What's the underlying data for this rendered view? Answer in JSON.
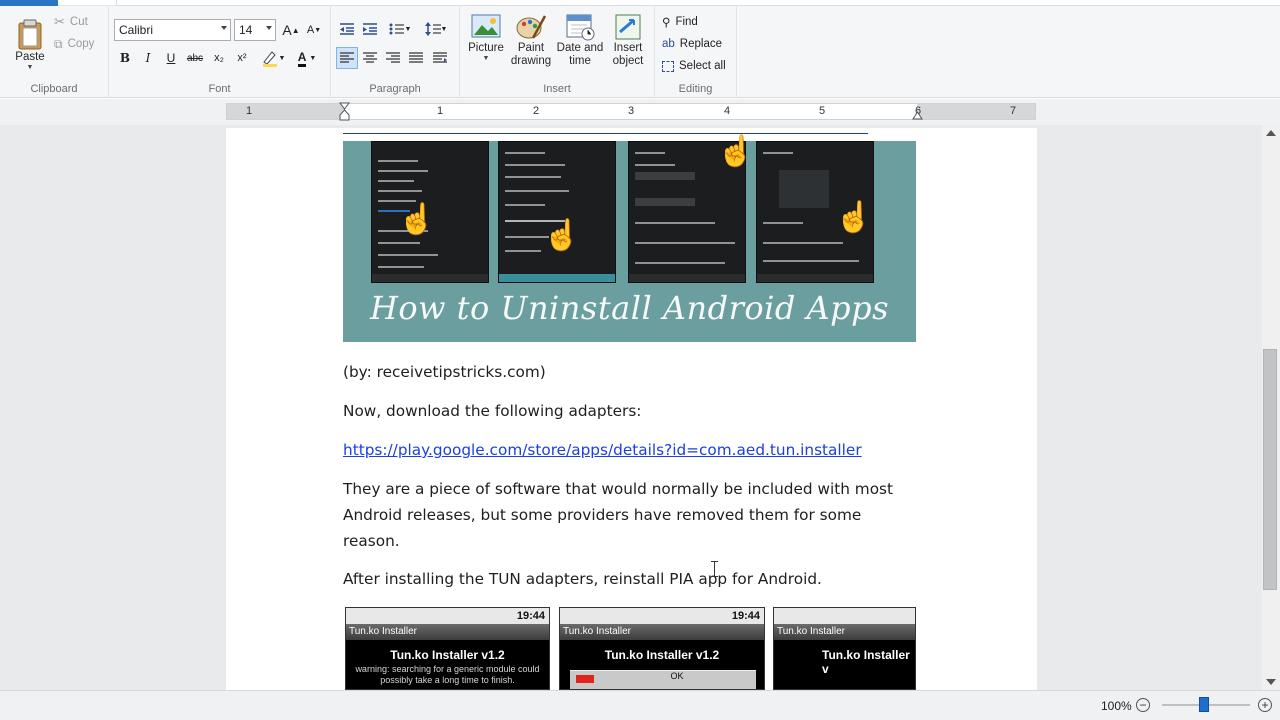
{
  "ribbon": {
    "clipboard": {
      "label": "Clipboard",
      "paste": "Paste",
      "cut": "Cut",
      "copy": "Copy"
    },
    "font": {
      "label": "Font",
      "family": "Calibri",
      "size": "14",
      "bold": "B",
      "italic": "I",
      "underline": "U",
      "strike": "abc",
      "subscript": "x₂",
      "superscript": "x²",
      "color_letter": "A",
      "grow_letter": "A",
      "shrink_letter": "A"
    },
    "paragraph": {
      "label": "Paragraph"
    },
    "insert": {
      "label": "Insert",
      "picture": "Picture",
      "paint": "Paint drawing",
      "datetime": "Date and time",
      "object": "Insert object"
    },
    "editing": {
      "label": "Editing",
      "find": "Find",
      "replace": "Replace",
      "select_all": "Select all"
    }
  },
  "ruler": {
    "numbers": [
      "1",
      "1",
      "2",
      "3",
      "4",
      "5",
      "6",
      "7"
    ]
  },
  "document": {
    "image1_title": "How to Uninstall Android Apps",
    "credit": "(by: receivetipstricks.com)",
    "line_download": "Now, download the following adapters:",
    "link": "https://play.google.com/store/apps/details?id=com.aed.tun.installer",
    "para_software_1": "They are a piece of software that would normally be included with most",
    "para_software_2": "Android releases, but some providers have removed them for some",
    "para_software_3": "reason.",
    "line_reinstall": "After installing the TUN adapters, reinstall PIA app for Android.",
    "shots": [
      {
        "time": "19:44",
        "titlebar": "Tun.ko Installer",
        "heading": "Tun.ko Installer v1.2",
        "sub": "warning: searching for a generic module could possibly take a long time to finish."
      },
      {
        "time": "19:44",
        "titlebar": "Tun.ko Installer",
        "heading": "Tun.ko Installer v1.2",
        "sub": "OK"
      },
      {
        "time": "",
        "titlebar": "Tun.ko Installer",
        "heading": "Tun.ko Installer v",
        "sub": ""
      }
    ]
  },
  "status": {
    "zoom": "100%",
    "zoom_out": "−",
    "zoom_in": "+",
    "zoom_level_percent": 100
  }
}
